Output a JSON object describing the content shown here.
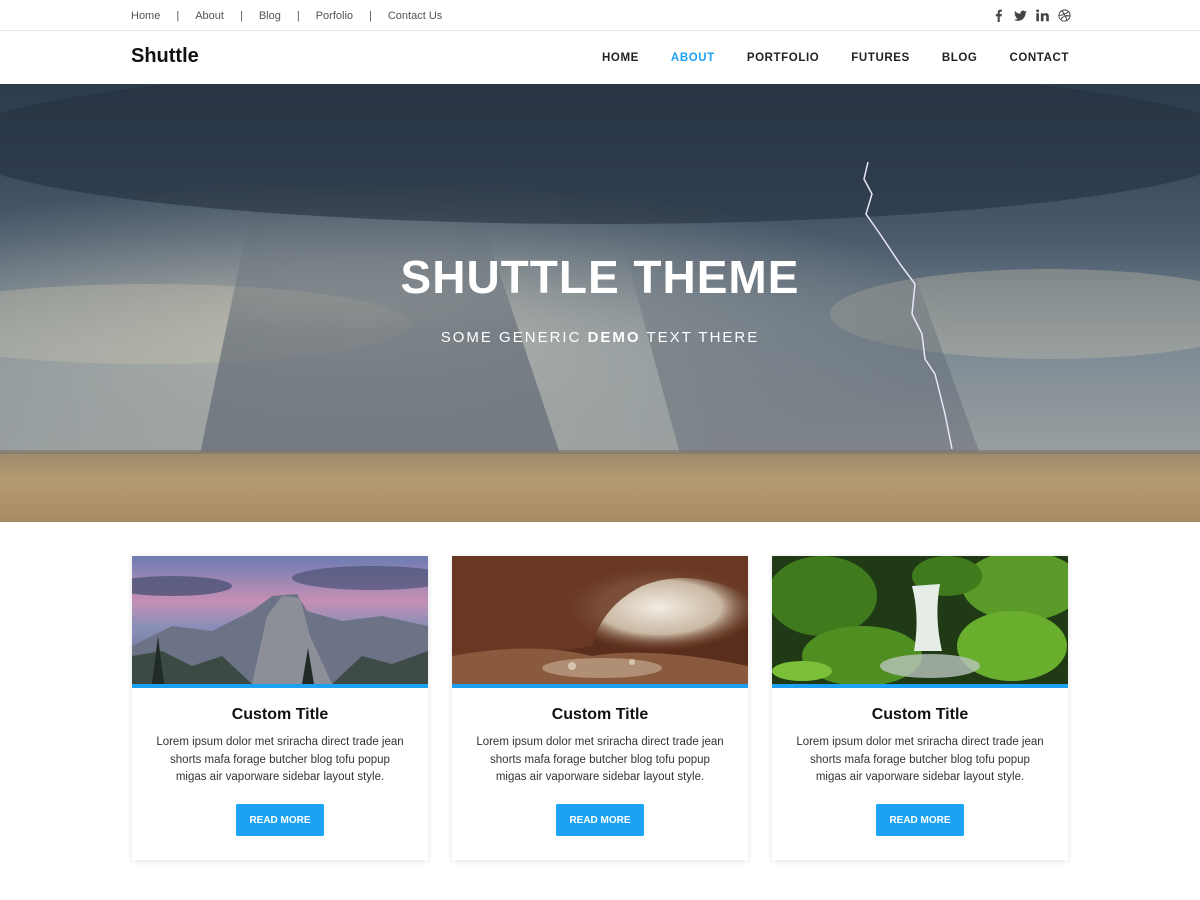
{
  "topbar": {
    "links": [
      "Home",
      "About",
      "Blog",
      "Porfolio",
      "Contact Us"
    ],
    "separator": "|",
    "social_icons": [
      "facebook-icon",
      "twitter-icon",
      "linkedin-icon",
      "dribbble-icon"
    ]
  },
  "nav": {
    "brand": "Shuttle",
    "items": [
      "HOME",
      "ABOUT",
      "PORTFOLIO",
      "FUTURES",
      "BLOG",
      "CONTACT"
    ],
    "active": "ABOUT"
  },
  "hero": {
    "title": "SHUTTLE THEME",
    "subtitle_pre": "SOME GENERIC ",
    "subtitle_bold": "DEMO",
    "subtitle_post": " TEXT THERE"
  },
  "cards": [
    {
      "title": "Custom Title",
      "text": "Lorem ipsum dolor met sriracha direct trade jean shorts mafa forage butcher blog tofu popup migas air vaporware sidebar layout style.",
      "button": "READ MORE"
    },
    {
      "title": "Custom Title",
      "text": "Lorem ipsum dolor met sriracha direct trade jean shorts mafa forage butcher blog tofu popup migas air vaporware sidebar layout style.",
      "button": "READ MORE"
    },
    {
      "title": "Custom Title",
      "text": "Lorem ipsum dolor met sriracha direct trade jean shorts mafa forage butcher blog tofu popup migas air vaporware sidebar layout style.",
      "button": "READ MORE"
    }
  ],
  "colors": {
    "accent": "#1da1f2",
    "text": "#222222"
  }
}
